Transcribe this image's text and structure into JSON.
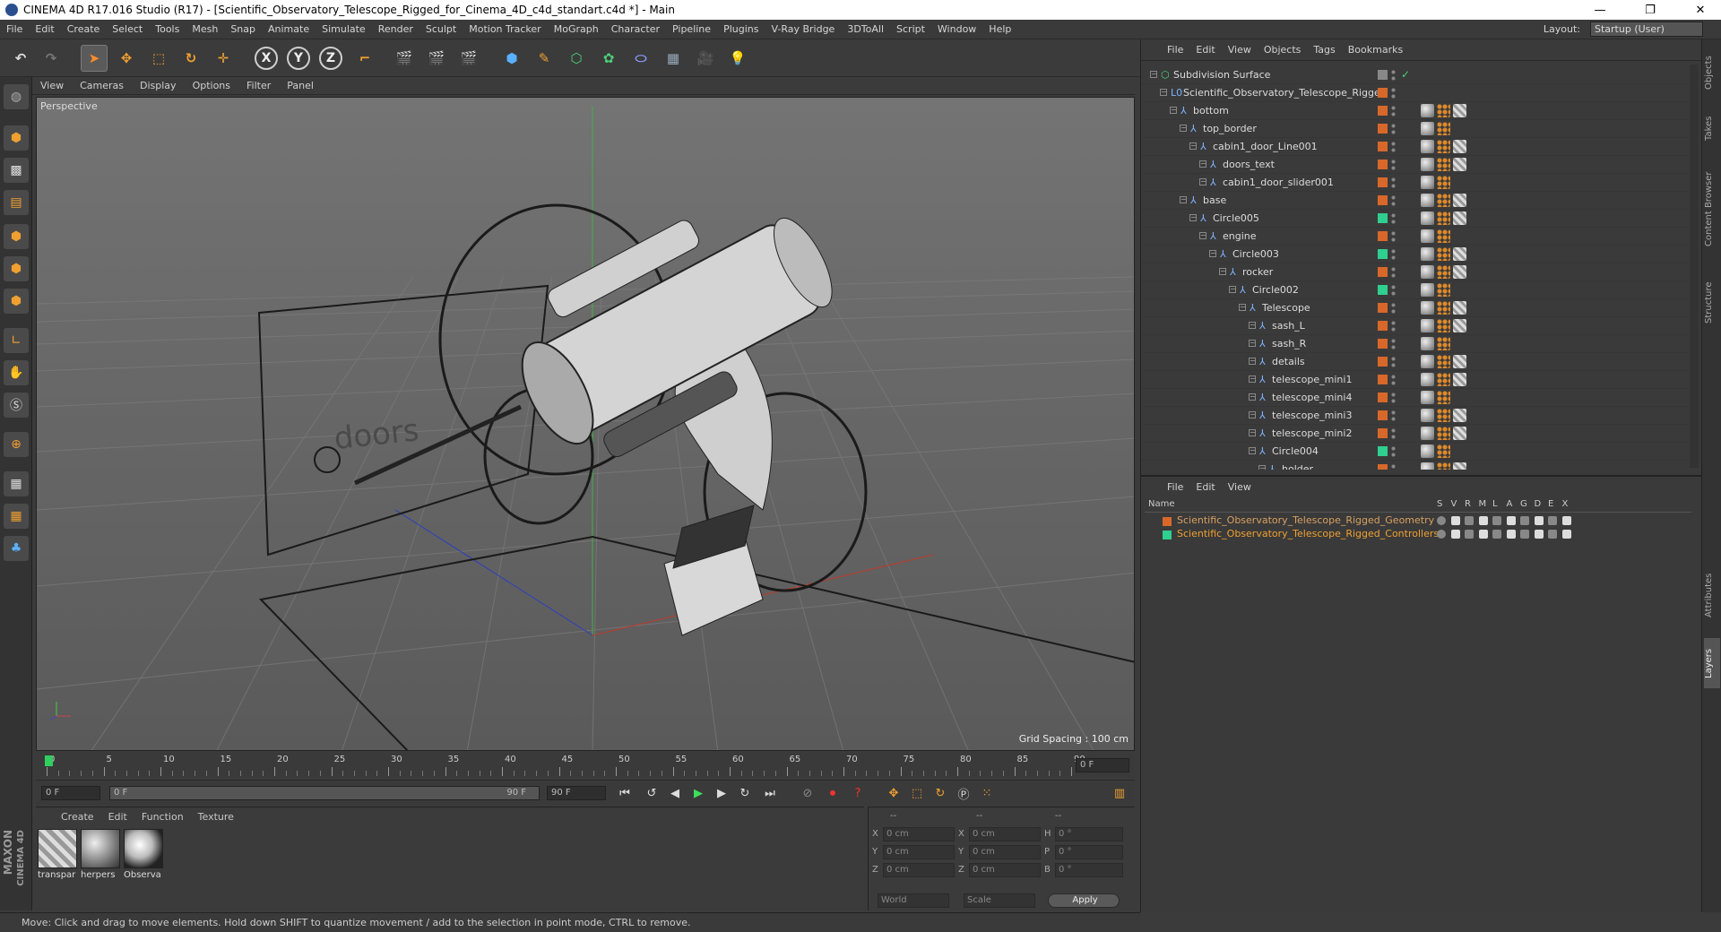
{
  "titlebar": {
    "title": "CINEMA 4D R17.016 Studio (R17) - [Scientific_Observatory_Telescope_Rigged_for_Cinema_4D_c4d_standart.c4d *] - Main",
    "minimize": "—",
    "restore": "❐",
    "close": "✕"
  },
  "menubar": {
    "items": [
      "File",
      "Edit",
      "Create",
      "Select",
      "Tools",
      "Mesh",
      "Snap",
      "Animate",
      "Simulate",
      "Render",
      "Sculpt",
      "Motion Tracker",
      "MoGraph",
      "Character",
      "Pipeline",
      "Plugins",
      "V-Ray Bridge",
      "3DToAll",
      "Script",
      "Window",
      "Help"
    ],
    "layout_label": "Layout:",
    "layout_value": "Startup (User)"
  },
  "toolbar": {
    "axis_x": "X",
    "axis_y": "Y",
    "axis_z": "Z"
  },
  "viewport": {
    "menu": [
      "View",
      "Cameras",
      "Display",
      "Options",
      "Filter",
      "Panel"
    ],
    "label": "Perspective",
    "grid_spacing": "Grid Spacing : 100 cm",
    "scene_text": "doors"
  },
  "timeline": {
    "ticks": [
      "0",
      "5",
      "10",
      "15",
      "20",
      "25",
      "30",
      "35",
      "40",
      "45",
      "50",
      "55",
      "60",
      "65",
      "70",
      "75",
      "80",
      "85",
      "90"
    ],
    "end_field": "0 F"
  },
  "transport": {
    "start": "0 F",
    "range_start": "0 F",
    "range_end": "90 F",
    "end": "90 F"
  },
  "materials": {
    "menu": [
      "Create",
      "Edit",
      "Function",
      "Texture"
    ],
    "items": [
      {
        "label": "transpar"
      },
      {
        "label": "herpers"
      },
      {
        "label": "Observa"
      }
    ]
  },
  "coords": {
    "header": [
      "--",
      "--",
      "--"
    ],
    "rows": [
      {
        "a": "X",
        "av": "0 cm",
        "b": "X",
        "bv": "0 cm",
        "c": "H",
        "cv": "0 °"
      },
      {
        "a": "Y",
        "av": "0 cm",
        "b": "Y",
        "bv": "0 cm",
        "c": "P",
        "cv": "0 °"
      },
      {
        "a": "Z",
        "av": "0 cm",
        "b": "Z",
        "bv": "0 cm",
        "c": "B",
        "cv": "0 °"
      }
    ],
    "world": "World",
    "scale": "Scale",
    "apply": "Apply"
  },
  "statusbar": {
    "text": "Move: Click and drag to move elements. Hold down SHIFT to quantize movement / add to the selection in point mode, CTRL to remove."
  },
  "branding": {
    "maxon": "MAXON",
    "cinema": "CINEMA 4D"
  },
  "objects": {
    "menu": [
      "File",
      "Edit",
      "View",
      "Objects",
      "Tags",
      "Bookmarks"
    ],
    "rows": [
      {
        "name": "Subdivision Surface",
        "indent": 0,
        "color": "#888888",
        "icon": "subdiv"
      },
      {
        "name": "Scientific_Observatory_Telescope_Rigged",
        "indent": 1,
        "color": "#d8682a",
        "icon": "null"
      },
      {
        "name": "bottom",
        "indent": 2,
        "color": "#d8682a",
        "icon": "bone"
      },
      {
        "name": "top_border",
        "indent": 3,
        "color": "#d8682a",
        "icon": "bone"
      },
      {
        "name": "cabin1_door_Line001",
        "indent": 4,
        "color": "#d8682a",
        "icon": "bone"
      },
      {
        "name": "doors_text",
        "indent": 5,
        "color": "#d8682a",
        "icon": "bone"
      },
      {
        "name": "cabin1_door_slider001",
        "indent": 5,
        "color": "#d8682a",
        "icon": "bone"
      },
      {
        "name": "base",
        "indent": 3,
        "color": "#d8682a",
        "icon": "bone"
      },
      {
        "name": "Circle005",
        "indent": 4,
        "color": "#2fcf8f",
        "icon": "bone"
      },
      {
        "name": "engine",
        "indent": 5,
        "color": "#d8682a",
        "icon": "bone"
      },
      {
        "name": "Circle003",
        "indent": 6,
        "color": "#2fcf8f",
        "icon": "bone"
      },
      {
        "name": "rocker",
        "indent": 7,
        "color": "#d8682a",
        "icon": "bone"
      },
      {
        "name": "Circle002",
        "indent": 8,
        "color": "#2fcf8f",
        "icon": "bone"
      },
      {
        "name": "Telescope",
        "indent": 9,
        "color": "#d8682a",
        "icon": "bone"
      },
      {
        "name": "sash_L",
        "indent": 10,
        "color": "#d8682a",
        "icon": "bone"
      },
      {
        "name": "sash_R",
        "indent": 10,
        "color": "#d8682a",
        "icon": "bone"
      },
      {
        "name": "details",
        "indent": 10,
        "color": "#d8682a",
        "icon": "bone"
      },
      {
        "name": "telescope_mini1",
        "indent": 10,
        "color": "#d8682a",
        "icon": "bone"
      },
      {
        "name": "telescope_mini4",
        "indent": 10,
        "color": "#d8682a",
        "icon": "bone"
      },
      {
        "name": "telescope_mini3",
        "indent": 10,
        "color": "#d8682a",
        "icon": "bone"
      },
      {
        "name": "telescope_mini2",
        "indent": 10,
        "color": "#d8682a",
        "icon": "bone"
      },
      {
        "name": "Circle004",
        "indent": 10,
        "color": "#2fcf8f",
        "icon": "bone"
      },
      {
        "name": "holder",
        "indent": 11,
        "color": "#d8682a",
        "icon": "bone"
      }
    ]
  },
  "layers": {
    "menu": [
      "File",
      "Edit",
      "View"
    ],
    "header": {
      "name": "Name",
      "cols": [
        "S",
        "V",
        "R",
        "M",
        "L",
        "A",
        "G",
        "D",
        "E",
        "X"
      ]
    },
    "rows": [
      {
        "name": "Scientific_Observatory_Telescope_Rigged_Geometry",
        "color": "#d8682a"
      },
      {
        "name": "Scientific_Observatory_Telescope_Rigged_Controllers",
        "color": "#2fcf8f"
      }
    ]
  },
  "sidetabs": [
    "Objects",
    "Takes",
    "Content Browser",
    "Structure",
    "Attributes",
    "Layers"
  ]
}
